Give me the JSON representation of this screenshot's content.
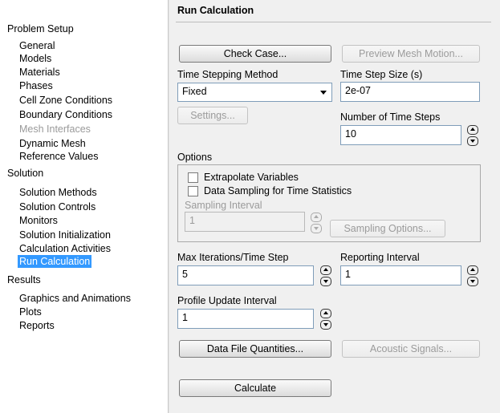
{
  "tree": {
    "sections": [
      {
        "label": "Problem Setup",
        "items": [
          {
            "label": "General",
            "state": "normal"
          },
          {
            "label": "Models",
            "state": "normal"
          },
          {
            "label": "Materials",
            "state": "normal"
          },
          {
            "label": "Phases",
            "state": "normal"
          },
          {
            "label": "Cell Zone Conditions",
            "state": "normal"
          },
          {
            "label": "Boundary Conditions",
            "state": "normal"
          },
          {
            "label": "Mesh Interfaces",
            "state": "disabled"
          },
          {
            "label": "Dynamic Mesh",
            "state": "normal"
          },
          {
            "label": "Reference Values",
            "state": "normal"
          }
        ]
      },
      {
        "label": "Solution",
        "items": [
          {
            "label": "Solution Methods",
            "state": "normal"
          },
          {
            "label": "Solution Controls",
            "state": "normal"
          },
          {
            "label": "Monitors",
            "state": "normal"
          },
          {
            "label": "Solution Initialization",
            "state": "normal"
          },
          {
            "label": "Calculation Activities",
            "state": "normal"
          },
          {
            "label": "Run Calculation",
            "state": "selected"
          }
        ]
      },
      {
        "label": "Results",
        "items": [
          {
            "label": "Graphics and Animations",
            "state": "normal"
          },
          {
            "label": "Plots",
            "state": "normal"
          },
          {
            "label": "Reports",
            "state": "normal"
          }
        ]
      }
    ]
  },
  "panel": {
    "title": "Run Calculation",
    "check_case_label": "Check Case...",
    "preview_mesh_label": "Preview Mesh Motion...",
    "time_stepping_method_label": "Time Stepping Method",
    "time_stepping_method_value": "Fixed",
    "time_step_size_label": "Time Step Size (s)",
    "time_step_size_value": "2e-07",
    "settings_label": "Settings...",
    "num_time_steps_label": "Number of Time Steps",
    "num_time_steps_value": "10",
    "options_label": "Options",
    "extrapolate_label": "Extrapolate Variables",
    "data_sampling_label": "Data Sampling for Time Statistics",
    "sampling_interval_label": "Sampling Interval",
    "sampling_interval_value": "1",
    "sampling_options_label": "Sampling Options...",
    "max_iter_label": "Max Iterations/Time Step",
    "max_iter_value": "5",
    "reporting_interval_label": "Reporting Interval",
    "reporting_interval_value": "1",
    "profile_update_label": "Profile Update Interval",
    "profile_update_value": "1",
    "data_file_quantities_label": "Data File Quantities...",
    "acoustic_signals_label": "Acoustic Signals...",
    "calculate_label": "Calculate"
  }
}
